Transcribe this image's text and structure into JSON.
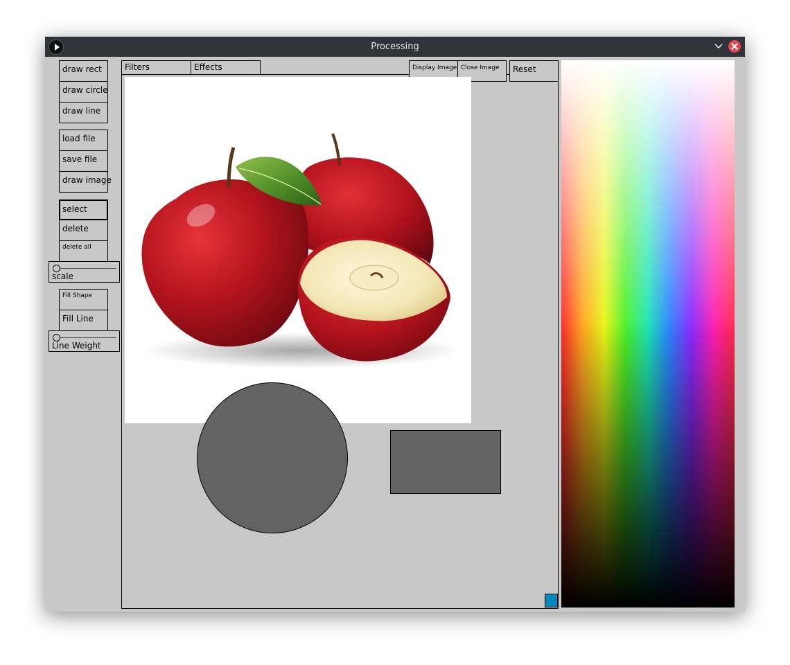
{
  "window": {
    "title": "Processing",
    "app_icon": "play-icon",
    "controls": [
      "chevron-down-icon",
      "close-icon"
    ]
  },
  "toolbar": {
    "draw_rect": "draw rect",
    "draw_circle": "draw circle",
    "draw_line": "draw line",
    "load_file": "load file",
    "save_file": "save file",
    "draw_image": "draw image",
    "select": "select",
    "delete": "delete",
    "delete_all": "delete all",
    "fill_shape": "Fill Shape",
    "fill_line": "Fill Line"
  },
  "sliders": {
    "scale": {
      "label": "scale",
      "value": 0
    },
    "line_weight": {
      "label": "Line Weight",
      "value": 0
    }
  },
  "tabs": {
    "filters": "Filters",
    "effects": "Effects",
    "display_image": "Display Image",
    "close_image": "Close Image",
    "reset": "Reset"
  },
  "canvas": {
    "image": "red apples with one halved apple",
    "shapes": [
      "circle",
      "rectangle"
    ],
    "shape_fill": "#636363",
    "selected_color": "#0087bd"
  },
  "palette": {
    "type": "hue-brightness color picker"
  }
}
